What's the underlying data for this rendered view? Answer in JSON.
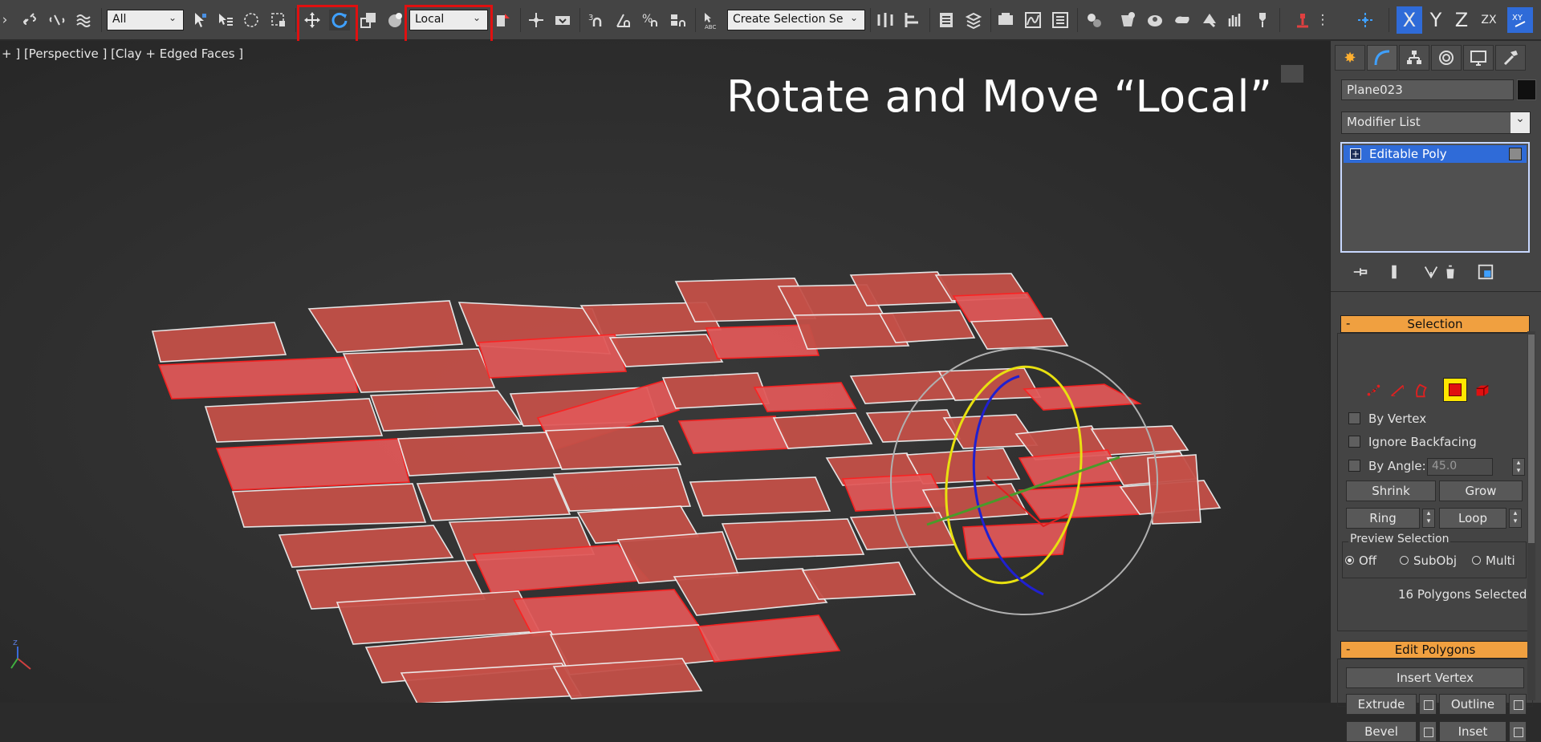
{
  "toolbar": {
    "selection_filter": "All",
    "coord_system": "Local",
    "selection_set": "Create Selection Se",
    "axis_x": "X",
    "axis_y": "Y",
    "axis_z": "Z",
    "axis_zx": "ZX",
    "active_tool": "rotate",
    "highlight_color": "#e01010"
  },
  "viewport": {
    "label": "+ ] [Perspective ] [Clay + Edged Faces ]",
    "caption": "Rotate and Move “Local”",
    "background": "#2b2b2b"
  },
  "panel": {
    "object_name": "Plane023",
    "modifier_list": "Modifier List",
    "stack_item": "Editable Poly",
    "selection_rollout": {
      "title": "Selection",
      "by_vertex": "By Vertex",
      "ignore_backfacing": "Ignore Backfacing",
      "by_angle": "By Angle:",
      "angle_value": "45.0",
      "shrink": "Shrink",
      "grow": "Grow",
      "ring": "Ring",
      "loop": "Loop",
      "preview_label": "Preview Selection",
      "preview_off": "Off",
      "preview_subobj": "SubObj",
      "preview_multi": "Multi",
      "status": "16 Polygons Selected",
      "active_level": "polygon"
    },
    "edit_polygons_rollout": {
      "title": "Edit Polygons",
      "insert_vertex": "Insert Vertex",
      "extrude": "Extrude",
      "outline": "Outline",
      "bevel": "Bevel",
      "inset": "Inset"
    },
    "accent_color": "#f0a040",
    "selection_color": "#2f6bd8"
  },
  "colors": {
    "face_fill": "#c45048",
    "selected_face_fill": "#e05858",
    "selected_edge": "#ff2020",
    "edge": "#f0f0f0",
    "gizmo_x": "#e02020",
    "gizmo_y": "#e8e010",
    "gizmo_z": "#2020d0",
    "gizmo_screen": "#b0b0b0"
  }
}
